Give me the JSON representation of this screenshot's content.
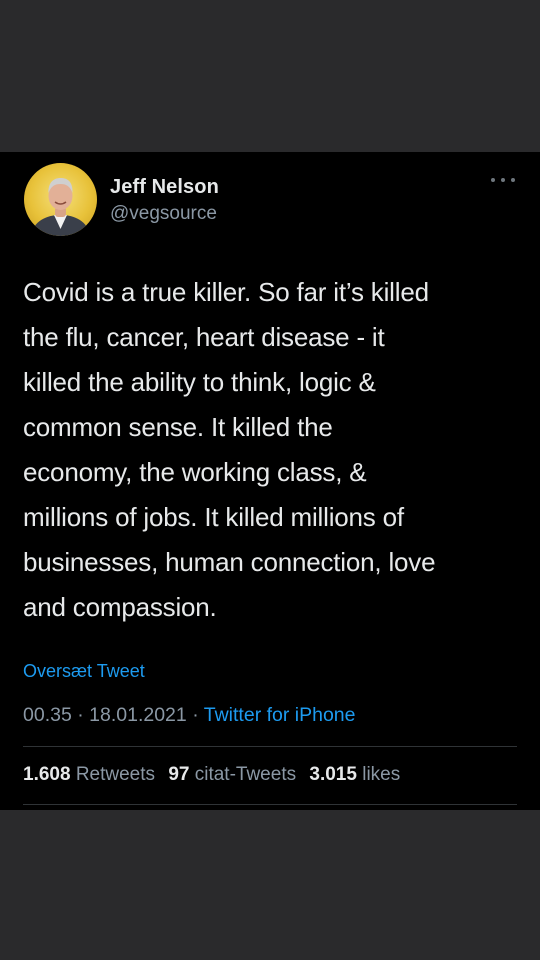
{
  "tweet": {
    "author_name": "Jeff Nelson",
    "author_handle": "@vegsource",
    "text_lines": [
      "Covid is a true killer. So far it’s killed",
      "the flu, cancer, heart disease - it",
      "killed the ability to think, logic &",
      "common sense. It killed the",
      "economy, the working class, &",
      "millions of jobs. It killed millions of",
      "businesses, human connection, love",
      "and compassion."
    ],
    "translate_label": "Oversæt Tweet",
    "time": "00.35",
    "separator": "·",
    "date": "18.01.2021",
    "source": "Twitter for iPhone",
    "stats": {
      "retweets_count": "1.608",
      "retweets_label": "Retweets",
      "quotes_count": "97",
      "quotes_label": "citat-Tweets",
      "likes_count": "3.015",
      "likes_label": "likes"
    }
  },
  "icons": {
    "more": "more-horizontal-icon",
    "avatar": "user-avatar"
  },
  "colors": {
    "background": "#2a2a2c",
    "card": "#000000",
    "text": "#e7e9ea",
    "secondary": "#8b98a5",
    "link": "#1d9bf0"
  }
}
